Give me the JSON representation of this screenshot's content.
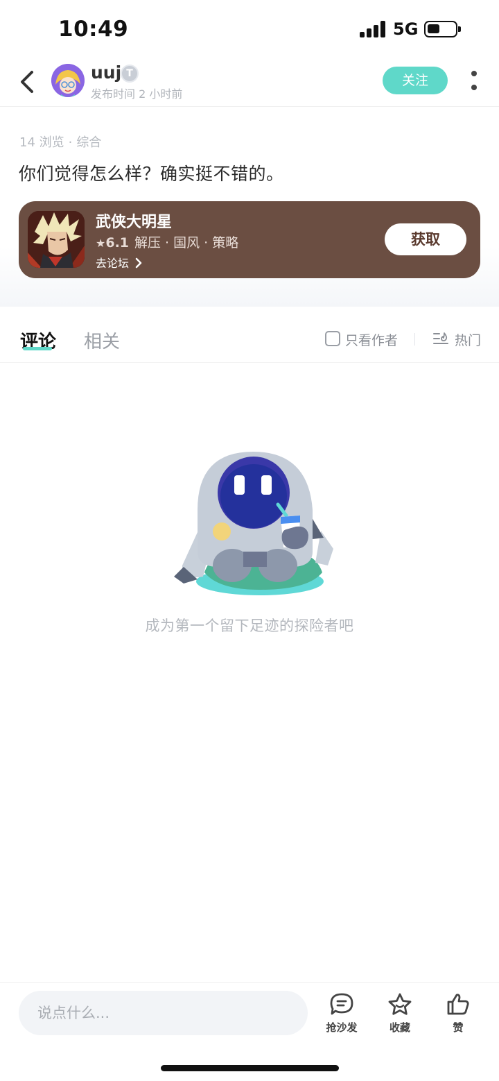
{
  "status_bar": {
    "time": "10:49",
    "network": "5G",
    "battery_level": 0.45
  },
  "header": {
    "username": "uuj",
    "badge_letter": "T",
    "post_time": "发布时间 2 小时前",
    "follow_label": "关注"
  },
  "post": {
    "views": "14 浏览",
    "separator": "·",
    "category": "综合",
    "text": "你们觉得怎么样？确实挺不错的。"
  },
  "game_card": {
    "name": "武侠大明星",
    "star": "★",
    "rating": "6.1",
    "tags": "解压 · 国风 · 策略",
    "forum_link": "去论坛",
    "chevron": "›",
    "get_label": "获取",
    "card_color": "#6b4e42"
  },
  "tabs": {
    "comments": "评论",
    "related": "相关",
    "author_only": "只看作者",
    "sort": "热门",
    "accent": "#5fd8c9"
  },
  "empty_state": {
    "message": "成为第一个留下足迹的探险者吧"
  },
  "bottom_bar": {
    "input_placeholder": "说点什么...",
    "sofa_label": "抢沙发",
    "favorite_label": "收藏",
    "like_label": "赞"
  }
}
